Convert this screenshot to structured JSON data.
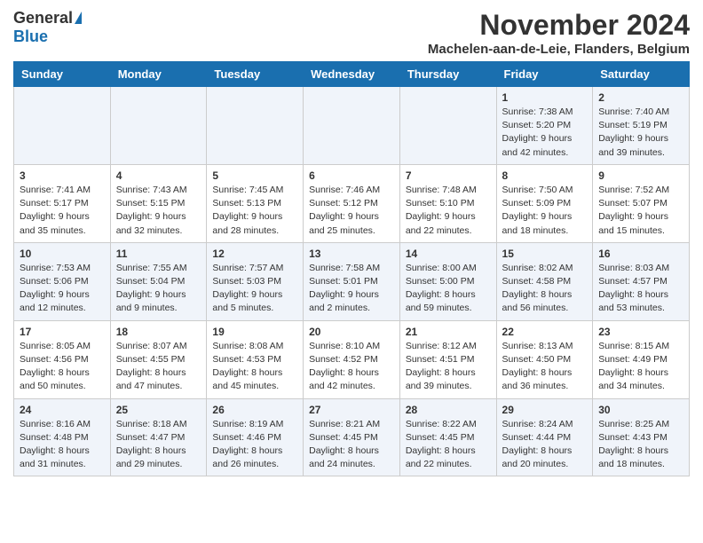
{
  "header": {
    "logo_general": "General",
    "logo_blue": "Blue",
    "month_title": "November 2024",
    "location": "Machelen-aan-de-Leie, Flanders, Belgium"
  },
  "days_of_week": [
    "Sunday",
    "Monday",
    "Tuesday",
    "Wednesday",
    "Thursday",
    "Friday",
    "Saturday"
  ],
  "weeks": [
    [
      {
        "day": "",
        "info": ""
      },
      {
        "day": "",
        "info": ""
      },
      {
        "day": "",
        "info": ""
      },
      {
        "day": "",
        "info": ""
      },
      {
        "day": "",
        "info": ""
      },
      {
        "day": "1",
        "info": "Sunrise: 7:38 AM\nSunset: 5:20 PM\nDaylight: 9 hours and 42 minutes."
      },
      {
        "day": "2",
        "info": "Sunrise: 7:40 AM\nSunset: 5:19 PM\nDaylight: 9 hours and 39 minutes."
      }
    ],
    [
      {
        "day": "3",
        "info": "Sunrise: 7:41 AM\nSunset: 5:17 PM\nDaylight: 9 hours and 35 minutes."
      },
      {
        "day": "4",
        "info": "Sunrise: 7:43 AM\nSunset: 5:15 PM\nDaylight: 9 hours and 32 minutes."
      },
      {
        "day": "5",
        "info": "Sunrise: 7:45 AM\nSunset: 5:13 PM\nDaylight: 9 hours and 28 minutes."
      },
      {
        "day": "6",
        "info": "Sunrise: 7:46 AM\nSunset: 5:12 PM\nDaylight: 9 hours and 25 minutes."
      },
      {
        "day": "7",
        "info": "Sunrise: 7:48 AM\nSunset: 5:10 PM\nDaylight: 9 hours and 22 minutes."
      },
      {
        "day": "8",
        "info": "Sunrise: 7:50 AM\nSunset: 5:09 PM\nDaylight: 9 hours and 18 minutes."
      },
      {
        "day": "9",
        "info": "Sunrise: 7:52 AM\nSunset: 5:07 PM\nDaylight: 9 hours and 15 minutes."
      }
    ],
    [
      {
        "day": "10",
        "info": "Sunrise: 7:53 AM\nSunset: 5:06 PM\nDaylight: 9 hours and 12 minutes."
      },
      {
        "day": "11",
        "info": "Sunrise: 7:55 AM\nSunset: 5:04 PM\nDaylight: 9 hours and 9 minutes."
      },
      {
        "day": "12",
        "info": "Sunrise: 7:57 AM\nSunset: 5:03 PM\nDaylight: 9 hours and 5 minutes."
      },
      {
        "day": "13",
        "info": "Sunrise: 7:58 AM\nSunset: 5:01 PM\nDaylight: 9 hours and 2 minutes."
      },
      {
        "day": "14",
        "info": "Sunrise: 8:00 AM\nSunset: 5:00 PM\nDaylight: 8 hours and 59 minutes."
      },
      {
        "day": "15",
        "info": "Sunrise: 8:02 AM\nSunset: 4:58 PM\nDaylight: 8 hours and 56 minutes."
      },
      {
        "day": "16",
        "info": "Sunrise: 8:03 AM\nSunset: 4:57 PM\nDaylight: 8 hours and 53 minutes."
      }
    ],
    [
      {
        "day": "17",
        "info": "Sunrise: 8:05 AM\nSunset: 4:56 PM\nDaylight: 8 hours and 50 minutes."
      },
      {
        "day": "18",
        "info": "Sunrise: 8:07 AM\nSunset: 4:55 PM\nDaylight: 8 hours and 47 minutes."
      },
      {
        "day": "19",
        "info": "Sunrise: 8:08 AM\nSunset: 4:53 PM\nDaylight: 8 hours and 45 minutes."
      },
      {
        "day": "20",
        "info": "Sunrise: 8:10 AM\nSunset: 4:52 PM\nDaylight: 8 hours and 42 minutes."
      },
      {
        "day": "21",
        "info": "Sunrise: 8:12 AM\nSunset: 4:51 PM\nDaylight: 8 hours and 39 minutes."
      },
      {
        "day": "22",
        "info": "Sunrise: 8:13 AM\nSunset: 4:50 PM\nDaylight: 8 hours and 36 minutes."
      },
      {
        "day": "23",
        "info": "Sunrise: 8:15 AM\nSunset: 4:49 PM\nDaylight: 8 hours and 34 minutes."
      }
    ],
    [
      {
        "day": "24",
        "info": "Sunrise: 8:16 AM\nSunset: 4:48 PM\nDaylight: 8 hours and 31 minutes."
      },
      {
        "day": "25",
        "info": "Sunrise: 8:18 AM\nSunset: 4:47 PM\nDaylight: 8 hours and 29 minutes."
      },
      {
        "day": "26",
        "info": "Sunrise: 8:19 AM\nSunset: 4:46 PM\nDaylight: 8 hours and 26 minutes."
      },
      {
        "day": "27",
        "info": "Sunrise: 8:21 AM\nSunset: 4:45 PM\nDaylight: 8 hours and 24 minutes."
      },
      {
        "day": "28",
        "info": "Sunrise: 8:22 AM\nSunset: 4:45 PM\nDaylight: 8 hours and 22 minutes."
      },
      {
        "day": "29",
        "info": "Sunrise: 8:24 AM\nSunset: 4:44 PM\nDaylight: 8 hours and 20 minutes."
      },
      {
        "day": "30",
        "info": "Sunrise: 8:25 AM\nSunset: 4:43 PM\nDaylight: 8 hours and 18 minutes."
      }
    ]
  ]
}
